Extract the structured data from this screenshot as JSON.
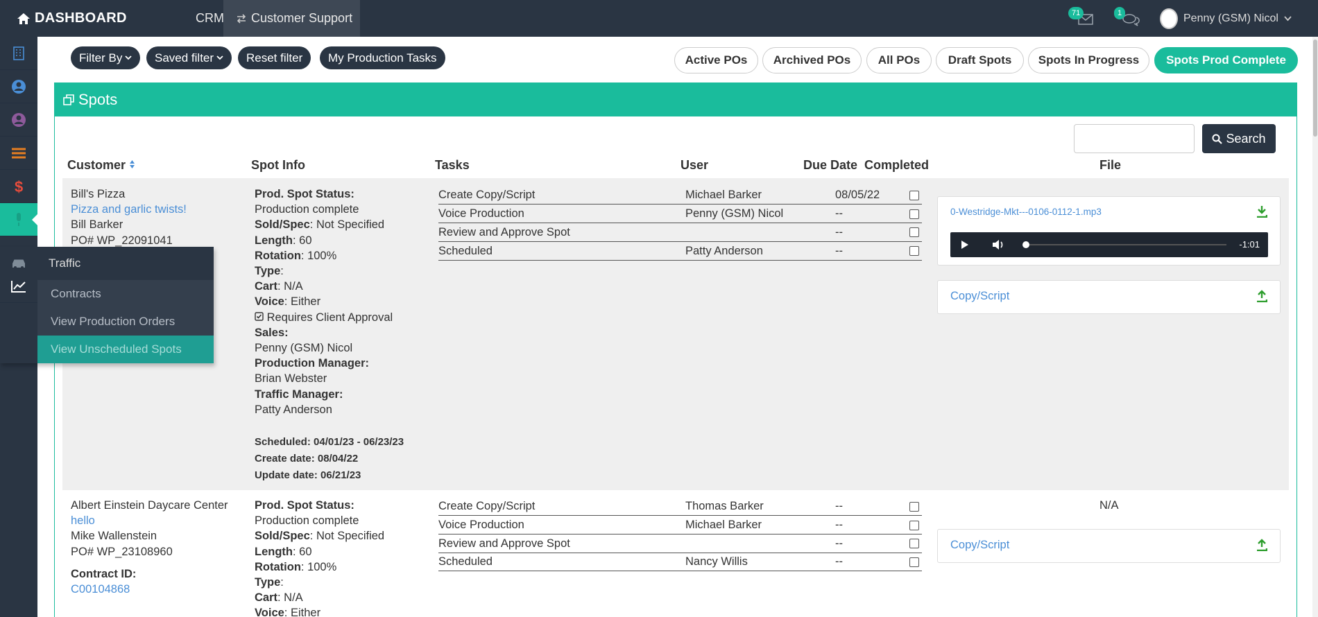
{
  "topbar": {
    "brand": "DASHBOARD",
    "crm": "CRM",
    "customer_support": "Customer Support",
    "mail_count": "71",
    "chat_count": "1",
    "user_name": "Penny (GSM) Nicol"
  },
  "flyout": {
    "title": "Traffic",
    "items": [
      "Contracts",
      "View Production Orders",
      "View Unscheduled Spots"
    ]
  },
  "filters": {
    "filter_by": "Filter By",
    "saved_filter": "Saved filter",
    "reset_filter": "Reset filter",
    "my_tasks": "My Production Tasks"
  },
  "tabs": [
    "Active POs",
    "Archived POs",
    "All POs",
    "Draft Spots",
    "Spots In Progress",
    "Spots Prod Complete"
  ],
  "active_tab": "Spots Prod Complete",
  "panel": {
    "title": "Spots"
  },
  "search": {
    "button": "Search",
    "value": ""
  },
  "columns": {
    "customer": "Customer",
    "spot_info": "Spot Info",
    "tasks": "Tasks",
    "user": "User",
    "due_date": "Due Date",
    "completed": "Completed",
    "file": "File"
  },
  "rows": [
    {
      "customer": "Bill's Pizza",
      "spot_name": "Pizza and garlic twists!",
      "contact": "Bill Barker",
      "po": "PO# WP_22091041",
      "prod_status_label": "Prod. Spot Status:",
      "prod_status": "Production complete",
      "sold_label": "Sold/Spec",
      "sold": ": Not Specified",
      "length_label": "Length",
      "length": ": 60",
      "rotation_label": "Rotation",
      "rotation": ": 100%",
      "type_label": "Type",
      "type": ":",
      "cart_label": "Cart",
      "cart": ": N/A",
      "voice_label": "Voice",
      "voice": ": Either",
      "approval": "Requires Client Approval",
      "sales_label": "Sales:",
      "sales": "Penny (GSM) Nicol",
      "pm_label": "Production Manager:",
      "pm": "Brian Webster",
      "tm_label": "Traffic Manager:",
      "tm": "Patty Anderson",
      "scheduled": "Scheduled: 04/01/23 - 06/23/23",
      "create_date": "Create date: 08/04/22",
      "update_date": "Update date: 06/21/23",
      "tasks": [
        {
          "name": "Create Copy/Script",
          "user": "Michael Barker",
          "due": "08/05/22"
        },
        {
          "name": "Voice Production",
          "user": "Penny (GSM) Nicol",
          "due": "--"
        },
        {
          "name": "Review and Approve Spot",
          "user": "",
          "due": "--"
        },
        {
          "name": "Scheduled",
          "user": "Patty Anderson",
          "due": "--"
        }
      ],
      "file_name": "0-Westridge-Mkt---0106-0112-1.mp3",
      "audio_time": "-1:01",
      "copy_script": "Copy/Script"
    },
    {
      "customer": "Albert Einstein Daycare Center",
      "spot_name": "hello",
      "contact": "Mike Wallenstein",
      "po": "PO# WP_23108960",
      "contract_label": "Contract ID:",
      "contract_id": "C00104868",
      "prod_status_label": "Prod. Spot Status:",
      "prod_status": "Production complete",
      "sold_label": "Sold/Spec",
      "sold": ": Not Specified",
      "length_label": "Length",
      "length": ": 60",
      "rotation_label": "Rotation",
      "rotation": ": 100%",
      "type_label": "Type",
      "type": ":",
      "cart_label": "Cart",
      "cart": ": N/A",
      "voice_label": "Voice",
      "voice": ": Either",
      "tasks": [
        {
          "name": "Create Copy/Script",
          "user": "Thomas Barker",
          "due": "--"
        },
        {
          "name": "Voice Production",
          "user": "Michael Barker",
          "due": "--"
        },
        {
          "name": "Review and Approve Spot",
          "user": "",
          "due": "--"
        },
        {
          "name": "Scheduled",
          "user": "Nancy Willis",
          "due": "--"
        }
      ],
      "file_na": "N/A",
      "copy_script": "Copy/Script"
    }
  ]
}
